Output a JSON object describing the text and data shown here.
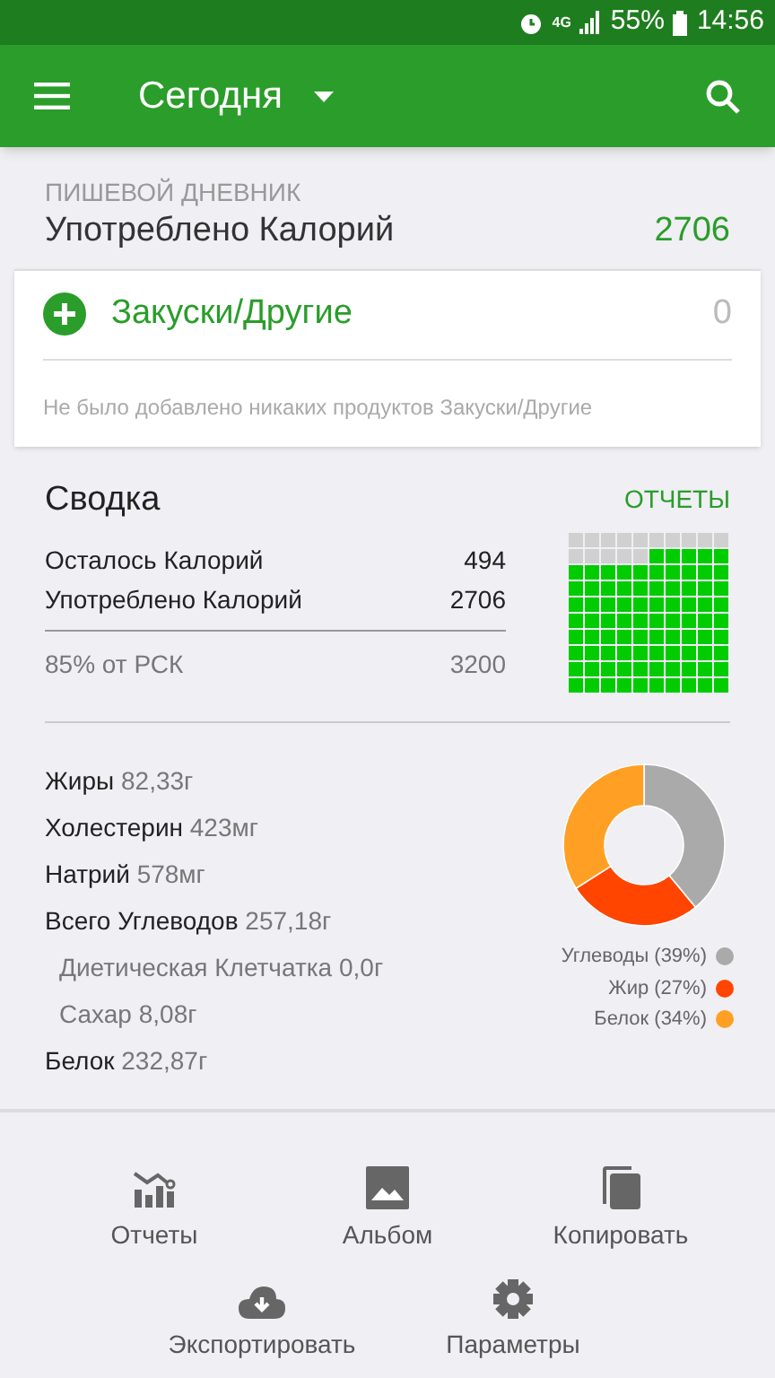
{
  "status_bar": {
    "battery": "55%",
    "time": "14:56",
    "network": "4G"
  },
  "app_bar": {
    "title": "Сегодня"
  },
  "diary": {
    "caption": "ПИШЕВОЙ ДНЕВНИК",
    "label": "Употреблено Калорий",
    "value": "2706"
  },
  "meal": {
    "title": "Закуски/Другие",
    "calories": "0",
    "empty_text": "Не было добавлено никаких продуктов Закуски/Другие"
  },
  "summary": {
    "title": "Сводка",
    "reports_link": "ОТЧЕТЫ",
    "rows": [
      {
        "label": "Осталось Калорий",
        "value": "494"
      },
      {
        "label": "Употреблено Калорий",
        "value": "2706"
      }
    ],
    "goal": {
      "label": "85% от РСК",
      "value": "3200"
    }
  },
  "nutrients": [
    {
      "label": "Жиры",
      "value": "82,33г"
    },
    {
      "label": "Холестерин",
      "value": "423мг"
    },
    {
      "label": "Натрий",
      "value": "578мг"
    },
    {
      "label": "Всего Углеводов",
      "value": "257,18г",
      "children": [
        {
          "label": "Диетическая Клетчатка",
          "value": "0,0г"
        },
        {
          "label": "Сахар",
          "value": "8,08г"
        }
      ]
    },
    {
      "label": "Белок",
      "value": "232,87г"
    }
  ],
  "macros": {
    "chart_data": {
      "type": "donut",
      "categories": [
        "Углеводы (39%)",
        "Жир (27%)",
        "Белок (34%)"
      ],
      "values": [
        39,
        27,
        34
      ]
    },
    "legend": [
      {
        "color": "#aaaaaa"
      },
      {
        "color": "#ff4500"
      },
      {
        "color": "#ffa024"
      }
    ]
  },
  "actions": [
    {
      "label": "Отчеты",
      "kind": "reports"
    },
    {
      "label": "Альбом",
      "kind": "album"
    },
    {
      "label": "Копировать",
      "kind": "copy"
    },
    {
      "label": "Экспортировать",
      "kind": "export"
    },
    {
      "label": "Параметры",
      "kind": "settings"
    }
  ]
}
